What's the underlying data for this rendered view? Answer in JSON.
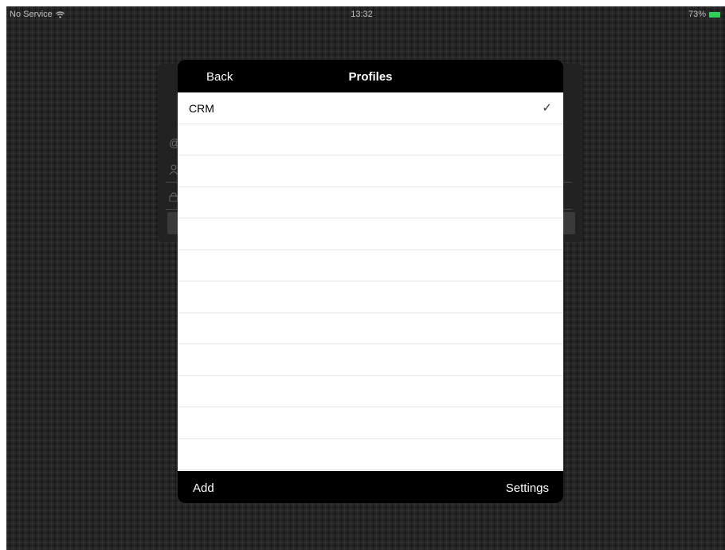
{
  "status_bar": {
    "carrier": "No Service",
    "time": "13:32",
    "battery_text": "73%"
  },
  "sheet": {
    "back_label": "Back",
    "title": "Profiles",
    "profiles": [
      {
        "label": "CRM",
        "selected": true,
        "check": "✓"
      }
    ],
    "empty_row_count": 11,
    "add_label": "Add",
    "settings_label": "Settings"
  },
  "colors": {
    "background": "#262626",
    "sheet_bars": "#000000",
    "list_background": "#ffffff",
    "battery": "#2fd05a"
  },
  "icons": {
    "wifi": "wifi-icon",
    "battery": "battery-icon",
    "check": "checkmark-icon"
  }
}
